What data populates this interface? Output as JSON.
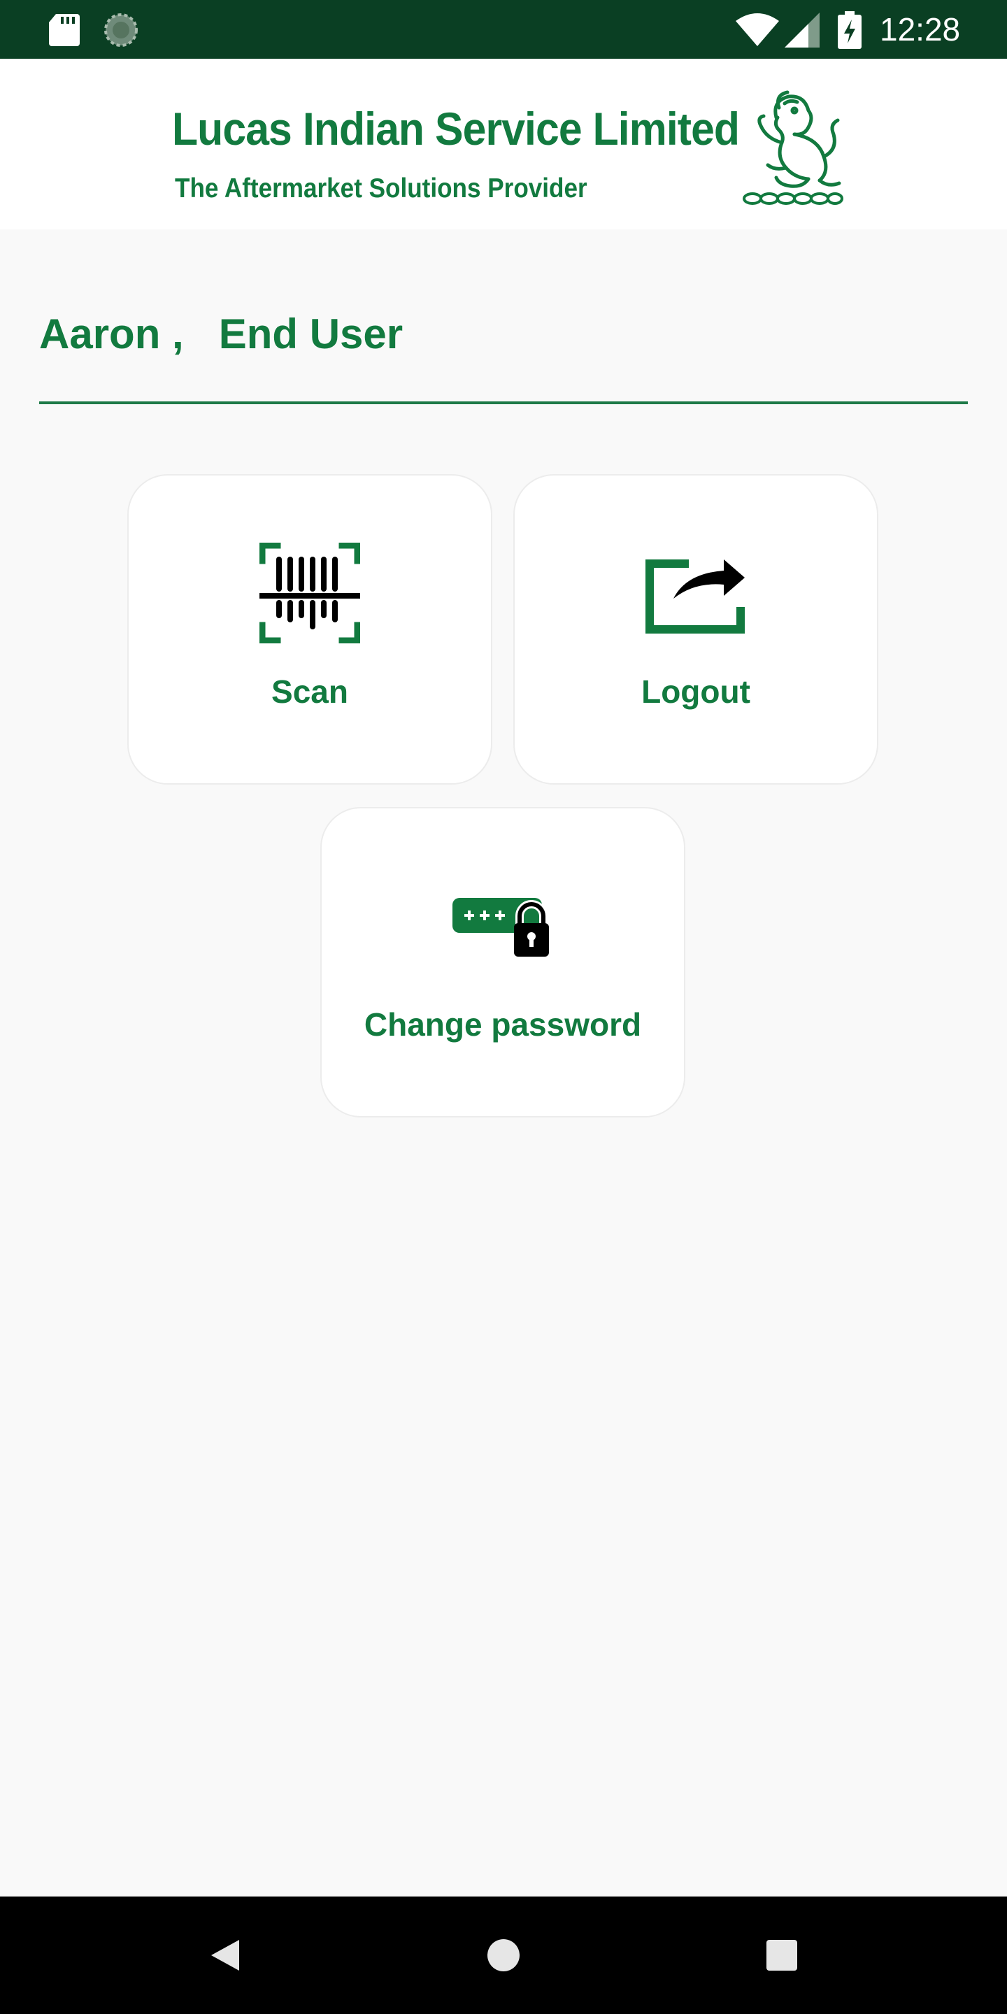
{
  "status_bar": {
    "time": "12:28",
    "icons": [
      "sd-card-icon",
      "sync-icon",
      "wifi-icon",
      "signal-icon",
      "battery-charging-icon"
    ]
  },
  "header": {
    "logo_title": "Lucas Indian Service Limited",
    "logo_tagline": "The Aftermarket Solutions Provider",
    "logo_emblem": "lion-emblem-icon"
  },
  "greeting": {
    "name": "Aaron",
    "separator": " ,   ",
    "role": "End User"
  },
  "tiles": [
    {
      "id": "scan",
      "label": "Scan",
      "icon": "barcode-scan-icon"
    },
    {
      "id": "logout",
      "label": "Logout",
      "icon": "share-arrow-icon"
    },
    {
      "id": "change_password",
      "label": "Change password",
      "icon": "password-lock-icon"
    }
  ],
  "nav_bar": {
    "buttons": [
      "back-icon",
      "home-icon",
      "recents-icon"
    ]
  },
  "colors": {
    "brand_green": "#127a3f",
    "status_bar": "#0a3f23",
    "background": "#f9f9f9"
  }
}
